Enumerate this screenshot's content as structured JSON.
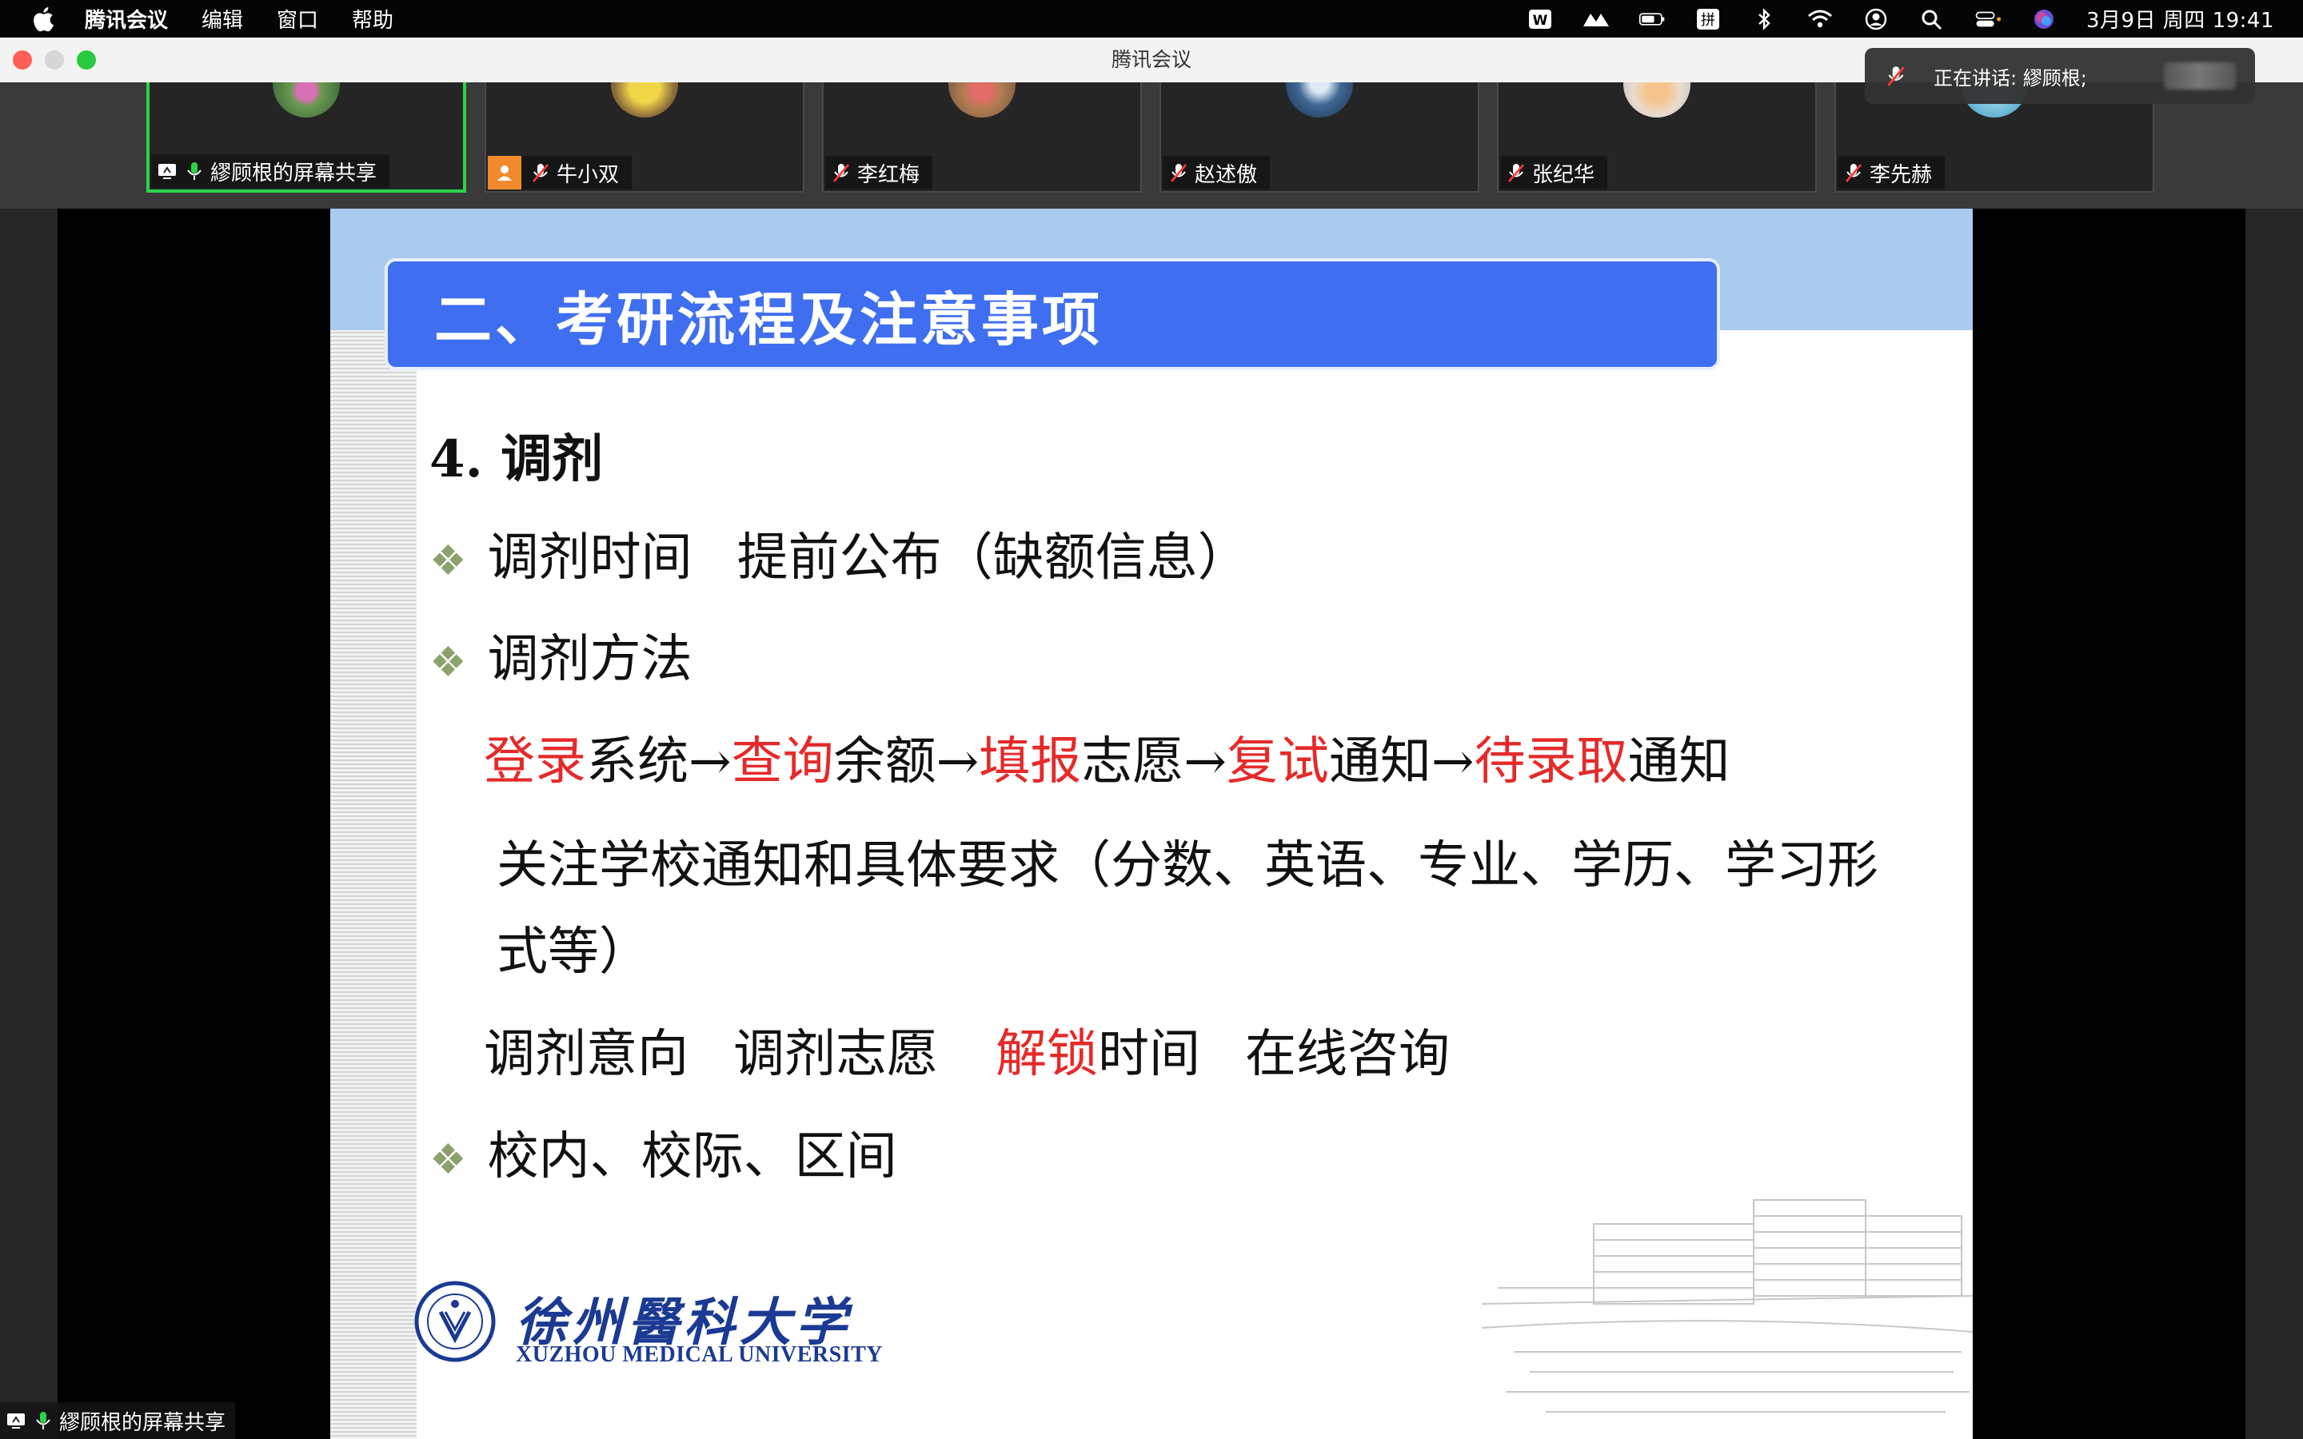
{
  "menubar": {
    "app_name": "腾讯会议",
    "items": [
      "编辑",
      "窗口",
      "帮助"
    ],
    "input_method": "拼",
    "clock": "3月9日 周四  19:41"
  },
  "window": {
    "title": "腾讯会议"
  },
  "participants": [
    {
      "name": "繆顾根的屏幕共享",
      "mic": "on",
      "active": true
    },
    {
      "name": "牛小双",
      "mic": "muted",
      "active": false
    },
    {
      "name": "李红梅",
      "mic": "muted",
      "active": false
    },
    {
      "name": "赵述傲",
      "mic": "muted",
      "active": false
    },
    {
      "name": "张纪华",
      "mic": "muted",
      "active": false
    },
    {
      "name": "李先赫",
      "mic": "muted",
      "active": false
    }
  ],
  "speaking": {
    "label": "正在讲话: 繆顾根;"
  },
  "slide": {
    "heading": "二、考研流程及注意事项",
    "subtitle": "4. 调剂",
    "bullet_glyph": "❖",
    "line1": {
      "a": "调剂时间",
      "b": "提前公布（缺额信息）"
    },
    "line2": "调剂方法",
    "line3": {
      "r1": "登录",
      "t1": "系统→",
      "r2": "查询",
      "t2": "余额→",
      "r3": "填报",
      "t3": "志愿→",
      "r4": "复试",
      "t4": "通知→",
      "r5": "待录取",
      "t5": "通知"
    },
    "line4": "关注学校通知和具体要求（分数、英语、专业、学历、学习形式等）",
    "line5": {
      "a": "调剂意向",
      "b": "调剂志愿",
      "r": "解锁",
      "c": "时间",
      "d": "在线咨询"
    },
    "line6": "校内、校际、区间",
    "logo_cn": "徐州醫科大学",
    "logo_en": "XUZHOU MEDICAL UNIVERSITY"
  },
  "share_label": "繆顾根的屏幕共享",
  "colors": {
    "accent_red": "#e52a2a",
    "heading_blue": "#3f6ef0",
    "active_green": "#2bd34a"
  }
}
